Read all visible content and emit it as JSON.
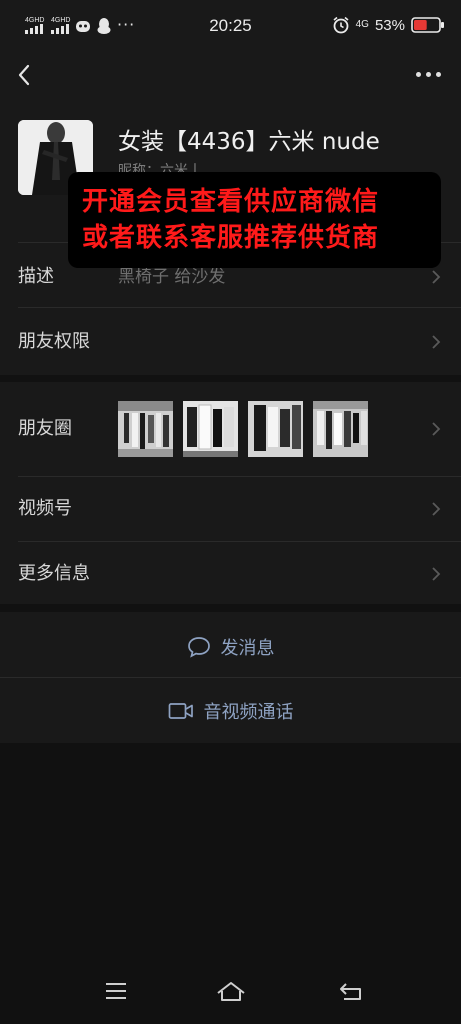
{
  "status": {
    "network_1": "4GHD",
    "network_2": "4GHD",
    "time": "20:25",
    "network_4g": "4G",
    "battery_percent": "53%",
    "battery_level": 0.53,
    "more_indicator": "···"
  },
  "nav": {
    "back_icon": "chevron-left-icon",
    "more_icon": "more-dots-icon"
  },
  "profile": {
    "name": "女装【4436】六米 nude",
    "nickname": "昵称：六米丨"
  },
  "banner": {
    "line1": "开通会员查看供应商微信",
    "line2": "或者联系客服推荐供货商"
  },
  "rows": {
    "description_label": "描述",
    "description_value": "黑椅子 给沙发",
    "permissions_label": "朋友权限",
    "moments_label": "朋友圈",
    "channels_label": "视频号",
    "more_info_label": "更多信息"
  },
  "actions": {
    "message_label": "发消息",
    "call_label": "音视频通话"
  },
  "colors": {
    "background": "#111111",
    "surface": "#191919",
    "banner_text": "#ff1a1a",
    "action_text": "#8ea2c2",
    "battery_red": "#e53935"
  }
}
